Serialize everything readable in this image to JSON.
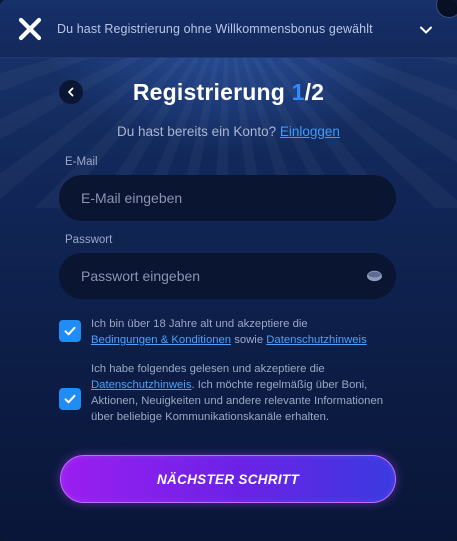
{
  "topbar": {
    "bonus_text": "Du hast Registrierung ohne Willkommensbonus gewählt",
    "close_icon": "close-icon",
    "chevron_icon": "chevron-down-icon"
  },
  "header": {
    "title_text": "Registrierung ",
    "title_step": "1",
    "title_total": "/2"
  },
  "login": {
    "prompt": "Du hast bereits ein Konto? ",
    "link_label": "Einloggen"
  },
  "form": {
    "email_label": "E-Mail",
    "email_placeholder": "E-Mail eingeben",
    "email_value": "",
    "password_label": "Passwort",
    "password_placeholder": "Passwort eingeben",
    "password_value": ""
  },
  "consents": [
    {
      "checked": true,
      "text_1": "Ich bin über 18 Jahre alt und akzeptiere die",
      "link_1": "Bedingungen & Konditionen",
      "text_2": " sowie ",
      "link_2": "Datenschutzhinweis"
    },
    {
      "checked": true,
      "text_1": "Ich habe folgendes gelesen und akzeptiere die",
      "link_1": "Datenschutzhinweis",
      "text_2": ". Ich möchte regelmäßig über Boni, Aktionen, Neuigkeiten und andere relevante Informationen über beliebige Kommunikationskanäle erhalten."
    }
  ],
  "next_button": {
    "label": "NÄCHSTER SCHRITT"
  },
  "colors": {
    "accent_blue": "#2d8cff",
    "checkbox_blue": "#1f8df5",
    "button_gradient_start": "#9b1ef0",
    "button_gradient_end": "#3a3ae0"
  }
}
